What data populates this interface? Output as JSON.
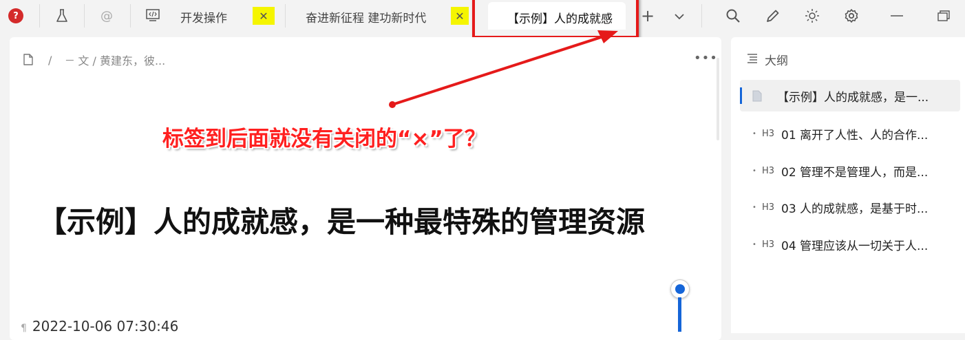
{
  "toolbar": {
    "tabs": [
      {
        "label": "开发操作"
      },
      {
        "label": "奋进新征程 建功新时代"
      },
      {
        "label": "【示例】人的成就感"
      }
    ],
    "close_glyph": "✕",
    "at_glyph": "@",
    "add_glyph": "+",
    "icons": [
      "help-icon",
      "flask-icon",
      "at-icon",
      "doc-icon",
      "add-tab-icon",
      "chevron-down-icon",
      "search-icon",
      "pencil-icon",
      "sun-icon",
      "gear-icon",
      "minimize-icon",
      "restore-icon"
    ]
  },
  "editor": {
    "breadcrumb": {
      "sep": "/",
      "path": "文 / 黄建东，彼...",
      "dash": "一"
    },
    "more": "•••",
    "title": "【示例】人的成就感，是一种最特殊的管理资源",
    "date": "2022-10-06 07:30:46"
  },
  "annotation": {
    "text": "标签到后面就没有关闭的“×”了？",
    "color": "#ff2020"
  },
  "outline": {
    "title": "大纲",
    "items": [
      {
        "label": "【示例】人的成就感，是一...",
        "level": "doc"
      },
      {
        "label": "01 离开了人性、人的合作...",
        "level": "H3"
      },
      {
        "label": "02 管理不是管理人，而是...",
        "level": "H3"
      },
      {
        "label": "03 人的成就感，是基于时...",
        "level": "H3"
      },
      {
        "label": "04 管理应该从一切关于人...",
        "level": "H3"
      }
    ],
    "h3_tag": "H3"
  },
  "colors": {
    "accent": "#1565d8",
    "highlight": "#f5f500",
    "annotation_red": "#e51a1a"
  }
}
